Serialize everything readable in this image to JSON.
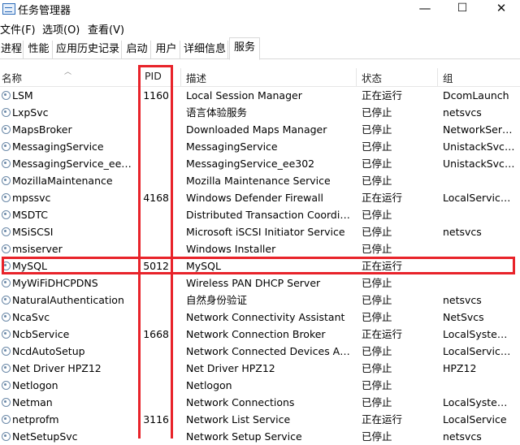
{
  "window": {
    "title": "任务管理器",
    "controls": [
      "—",
      "☐",
      "✕"
    ]
  },
  "menubar": [
    "文件(F)",
    "选项(O)",
    "查看(V)"
  ],
  "tabs": [
    {
      "label": "进程"
    },
    {
      "label": "性能"
    },
    {
      "label": "应用历史记录"
    },
    {
      "label": "启动"
    },
    {
      "label": "用户"
    },
    {
      "label": "详细信息"
    },
    {
      "label": "服务",
      "active": true
    }
  ],
  "columns": {
    "name": "名称",
    "pid": "PID",
    "desc": "描述",
    "status": "状态",
    "group": "组"
  },
  "services": [
    {
      "name": "LSM",
      "pid": "1160",
      "desc": "Local Session Manager",
      "status": "正在运行",
      "group": "DcomLaunch"
    },
    {
      "name": "LxpSvc",
      "pid": "",
      "desc": "语言体验服务",
      "status": "已停止",
      "group": "netsvcs"
    },
    {
      "name": "MapsBroker",
      "pid": "",
      "desc": "Downloaded Maps Manager",
      "status": "已停止",
      "group": "NetworkServ..."
    },
    {
      "name": "MessagingService",
      "pid": "",
      "desc": "MessagingService",
      "status": "已停止",
      "group": "UnistackSvcG..."
    },
    {
      "name": "MessagingService_ee302",
      "pid": "",
      "desc": "MessagingService_ee302",
      "status": "已停止",
      "group": "UnistackSvcG..."
    },
    {
      "name": "MozillaMaintenance",
      "pid": "",
      "desc": "Mozilla Maintenance Service",
      "status": "已停止",
      "group": ""
    },
    {
      "name": "mpssvc",
      "pid": "4168",
      "desc": "Windows Defender Firewall",
      "status": "正在运行",
      "group": "LocalService..."
    },
    {
      "name": "MSDTC",
      "pid": "",
      "desc": "Distributed Transaction Coordina...",
      "status": "已停止",
      "group": ""
    },
    {
      "name": "MSiSCSI",
      "pid": "",
      "desc": "Microsoft iSCSI Initiator Service",
      "status": "已停止",
      "group": "netsvcs"
    },
    {
      "name": "msiserver",
      "pid": "",
      "desc": "Windows Installer",
      "status": "已停止",
      "group": ""
    },
    {
      "name": "MySQL",
      "pid": "5012",
      "desc": "MySQL",
      "status": "正在运行",
      "group": ""
    },
    {
      "name": "MyWiFiDHCPDNS",
      "pid": "",
      "desc": "Wireless PAN DHCP Server",
      "status": "已停止",
      "group": ""
    },
    {
      "name": "NaturalAuthentication",
      "pid": "",
      "desc": "自然身份验证",
      "status": "已停止",
      "group": "netsvcs"
    },
    {
      "name": "NcaSvc",
      "pid": "",
      "desc": "Network Connectivity Assistant",
      "status": "已停止",
      "group": "NetSvcs"
    },
    {
      "name": "NcbService",
      "pid": "1668",
      "desc": "Network Connection Broker",
      "status": "正在运行",
      "group": "LocalSystem..."
    },
    {
      "name": "NcdAutoSetup",
      "pid": "",
      "desc": "Network Connected Devices Aut...",
      "status": "已停止",
      "group": "LocalService..."
    },
    {
      "name": "Net Driver HPZ12",
      "pid": "",
      "desc": "Net Driver HPZ12",
      "status": "已停止",
      "group": "HPZ12"
    },
    {
      "name": "Netlogon",
      "pid": "",
      "desc": "Netlogon",
      "status": "已停止",
      "group": ""
    },
    {
      "name": "Netman",
      "pid": "",
      "desc": "Network Connections",
      "status": "已停止",
      "group": "LocalSystem..."
    },
    {
      "name": "netprofm",
      "pid": "3116",
      "desc": "Network List Service",
      "status": "正在运行",
      "group": "LocalService"
    },
    {
      "name": "NetSetupSvc",
      "pid": "",
      "desc": "Network Setup Service",
      "status": "已停止",
      "group": "netsvcs"
    }
  ],
  "highlight_color": "#e8232a"
}
